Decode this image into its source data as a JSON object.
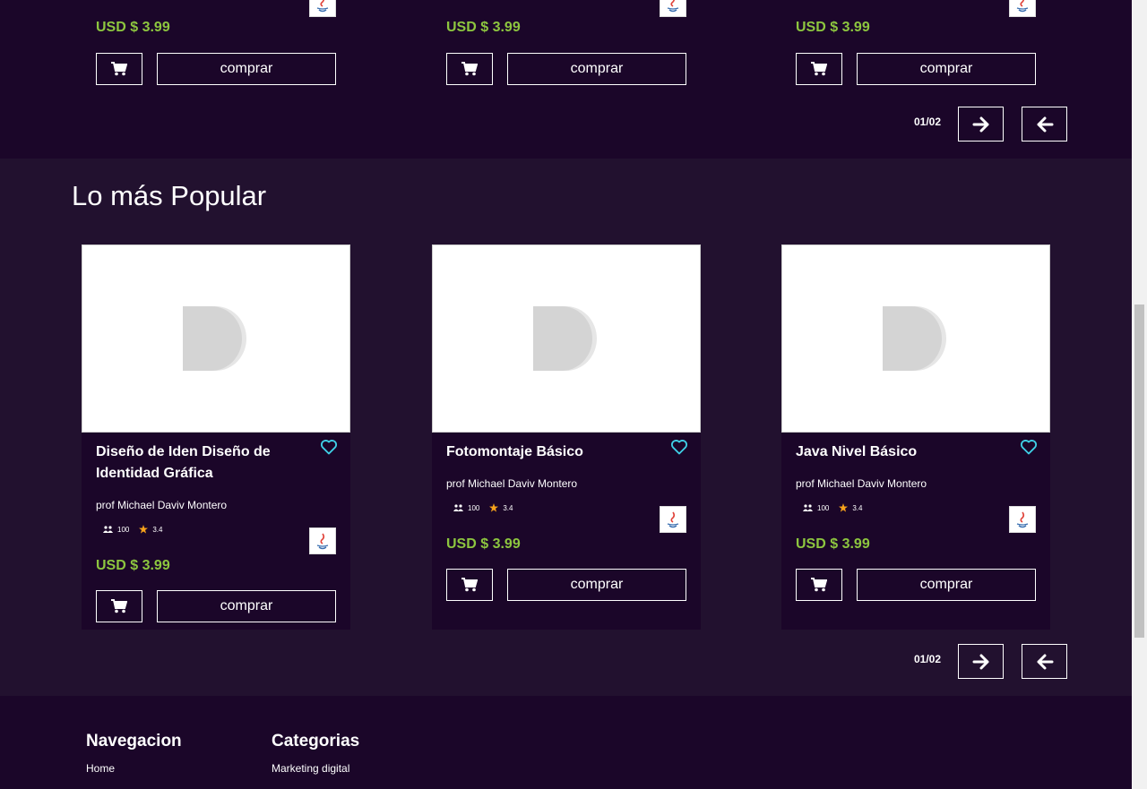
{
  "top_section": {
    "items": [
      {
        "price": "USD $ 3.99",
        "buy_label": "comprar"
      },
      {
        "price": "USD $ 3.99",
        "buy_label": "comprar"
      },
      {
        "price": "USD $ 3.99",
        "buy_label": "comprar"
      }
    ],
    "pager": "01/02"
  },
  "popular": {
    "title": "Lo más Popular",
    "courses": [
      {
        "title": "Diseño de Iden Diseño de Identidad Gráfica",
        "professor": "prof Michael Daviv Montero",
        "students": "100",
        "rating": "3.4",
        "price": "USD $ 3.99",
        "buy_label": "comprar"
      },
      {
        "title": "Fotomontaje Básico",
        "professor": "prof Michael Daviv Montero",
        "students": "100",
        "rating": "3.4",
        "price": "USD $ 3.99",
        "buy_label": "comprar"
      },
      {
        "title": "Java Nivel Básico",
        "professor": "prof Michael Daviv Montero",
        "students": "100",
        "rating": "3.4",
        "price": "USD $ 3.99",
        "buy_label": "comprar"
      }
    ],
    "pager": "01/02"
  },
  "footer": {
    "nav_title": "Navegacion",
    "nav_links": [
      "Home"
    ],
    "cat_title": "Categorias",
    "cat_links": [
      "Marketing digital"
    ]
  },
  "colors": {
    "price_green": "#8dc63f",
    "heart_cyan": "#3fd0e6",
    "star_orange": "#f7a21b",
    "bg_dark": "#1b0629",
    "bg_section": "#22112f"
  },
  "icons": {
    "cart": "shopping-cart-icon",
    "heart": "heart-outline-icon",
    "users": "users-icon",
    "star": "star-icon",
    "next": "arrow-right-icon",
    "prev": "arrow-left-icon",
    "course_logo": "java-logo-icon",
    "placeholder": "image-placeholder-icon"
  }
}
